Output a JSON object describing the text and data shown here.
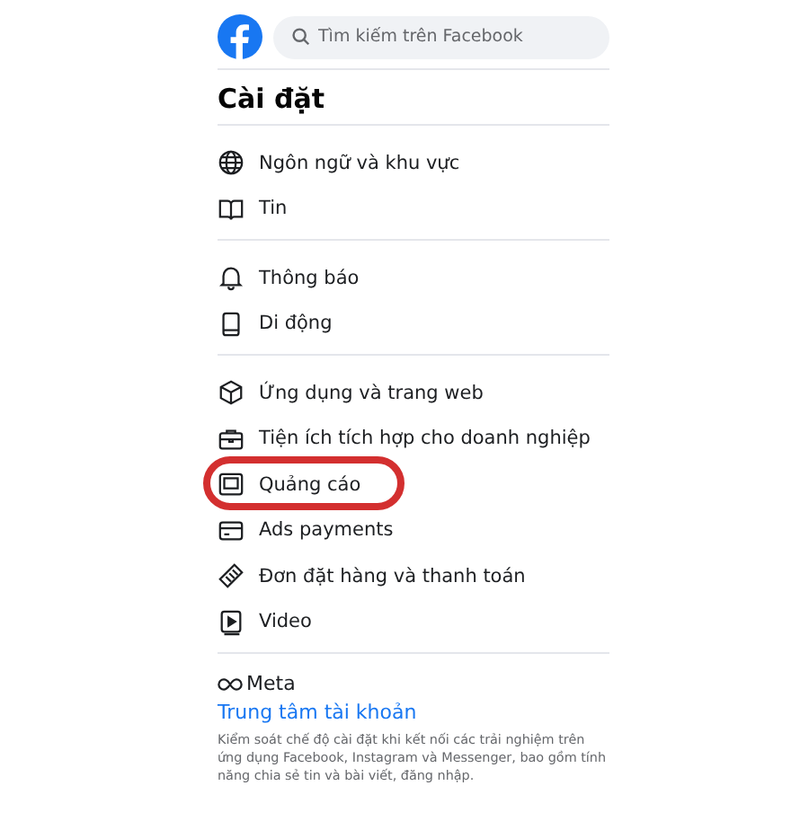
{
  "header": {
    "search": {
      "placeholder": "Tìm kiếm trên Facebook"
    }
  },
  "title": "Cài đặt",
  "sections": [
    {
      "items": [
        {
          "label": "Ngôn ngữ và khu vực",
          "circled": false
        },
        {
          "label": "Tin",
          "circled": false
        }
      ]
    },
    {
      "items": [
        {
          "label": "Thông báo",
          "circled": false
        },
        {
          "label": "Di động",
          "circled": false
        }
      ]
    },
    {
      "items": [
        {
          "label": "Ứng dụng và trang web",
          "circled": false
        },
        {
          "label": "Tiện ích tích hợp cho doanh nghiệp",
          "circled": false
        },
        {
          "label": "Quảng cáo",
          "circled": true
        },
        {
          "label": "Ads payments",
          "circled": false
        },
        {
          "label": "Đơn đặt hàng và thanh toán",
          "circled": false
        },
        {
          "label": "Video",
          "circled": false
        }
      ]
    }
  ],
  "meta": {
    "brand": "Meta",
    "link": "Trung tâm tài khoản",
    "description": "Kiểm soát chế độ cài đặt khi kết nối các trải nghiệm trên ứng dụng Facebook, Instagram và Messenger, bao gồm tính năng chia sẻ tin và bài viết, đăng nhập."
  }
}
